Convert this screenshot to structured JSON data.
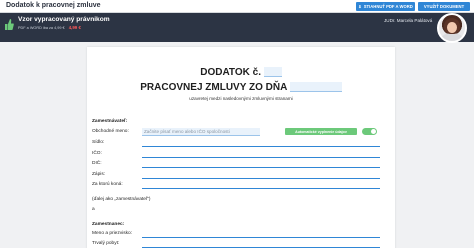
{
  "header": {
    "app_title": "Dodatok k pracovnej zmluve",
    "download_label": "STIAHNUŤ PDF A WORD",
    "use_label": "VYUŽIŤ DOKUMENT"
  },
  "template": {
    "title": "Vzor vypracovaný právnikom",
    "meta": "PDF a WORD iba za 4,99 €",
    "price": "4,99 €",
    "author": "JUDr. Marcela Palátová"
  },
  "document": {
    "title_part1": "DODATOK č.",
    "title_part2": "PRACOVNEJ ZMLUVY ZO DŇA",
    "subtitle": "uzavretej medzi nasledovnými zmluvnými stranami",
    "employer_heading": "Zamestnávateľ:",
    "search_placeholder": "Začnite písať meno alebo IČO spoločnosti",
    "autofill_label": "Automatické vyplnenie údajov",
    "autofill_on": true,
    "employer_fields": [
      "Obchodné meno:",
      "Sídlo:",
      "IČO:",
      "DIČ:",
      "Zápis:",
      "Za ktorú koná:"
    ],
    "employer_alias": "(ďalej ako „zamestnávateľ“)",
    "conjunction": "a",
    "employee_heading": "Zamestnanec:",
    "employee_fields": [
      "Meno a priezvisko:",
      "Trvalý pobyt:"
    ]
  }
}
